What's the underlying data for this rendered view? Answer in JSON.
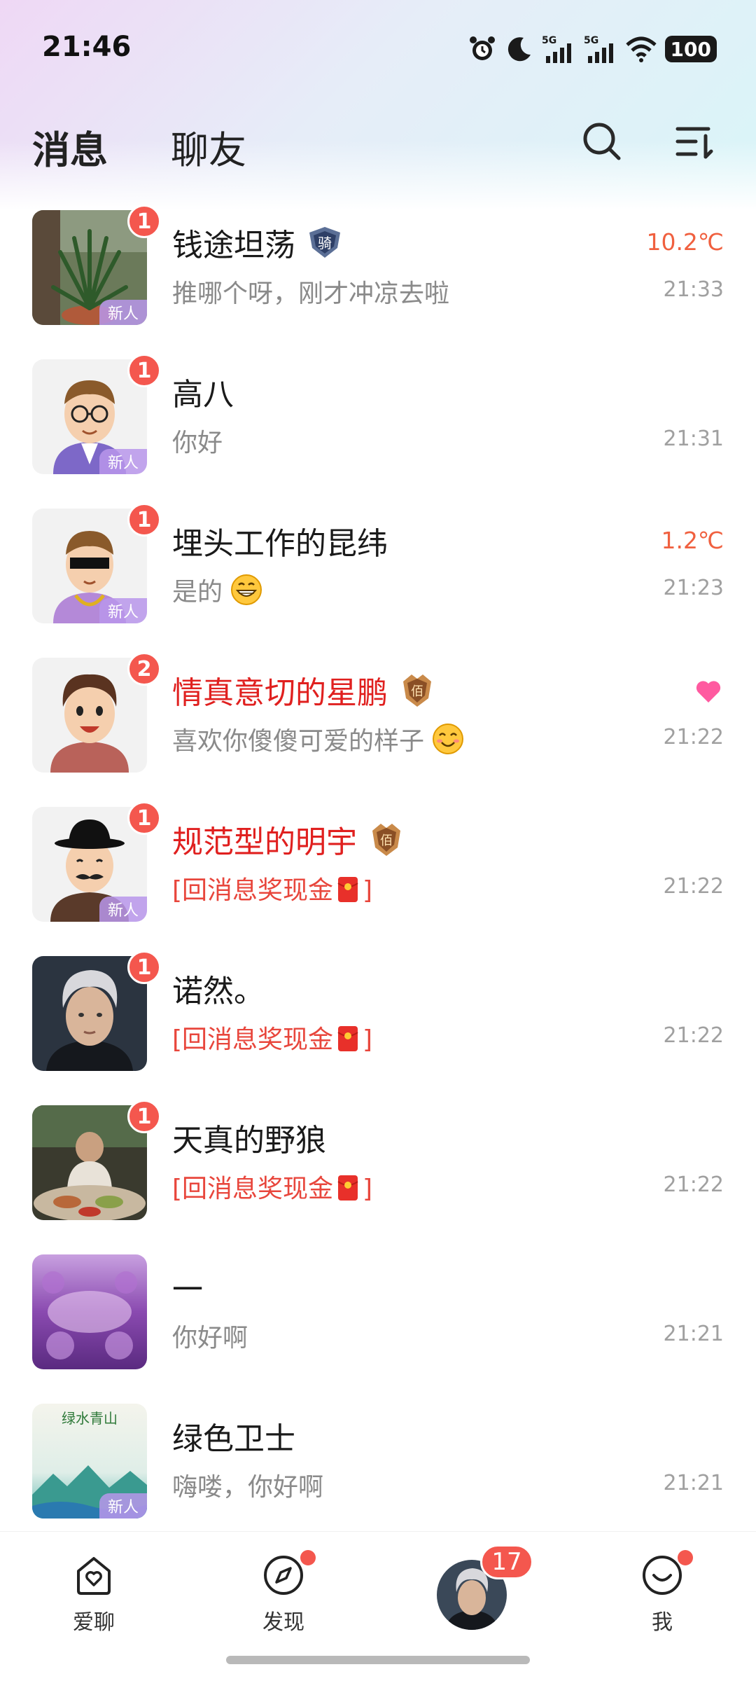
{
  "status_bar": {
    "time": "21:46",
    "battery": "100",
    "network_1": "5G",
    "network_2": "5G"
  },
  "header": {
    "tabs": [
      {
        "label": "消息",
        "active": true
      },
      {
        "label": "聊友",
        "active": false
      }
    ]
  },
  "conversations": [
    {
      "name": "钱途坦荡",
      "preview": "推哪个呀，刚才冲凉去啦",
      "time": "21:33",
      "temperature": "10.2℃",
      "unread": "1",
      "new_tag": "新人",
      "badge": "骑"
    },
    {
      "name": "高八",
      "preview": "你好",
      "time": "21:31",
      "unread": "1",
      "new_tag": "新人"
    },
    {
      "name": "埋头工作的昆纬",
      "preview": "是的",
      "time": "21:23",
      "temperature": "1.2℃",
      "unread": "1",
      "new_tag": "新人"
    },
    {
      "name": "情真意切的星鹏",
      "preview": "喜欢你傻傻可爱的样子",
      "time": "21:22",
      "unread": "2",
      "badge": "佰"
    },
    {
      "name": "规范型的明宇",
      "preview_prefix": "[回消息奖现金",
      "preview_suffix": "]",
      "time": "21:22",
      "unread": "1",
      "new_tag": "新人",
      "badge": "佰"
    },
    {
      "name": "诺然。",
      "preview_prefix": "[回消息奖现金",
      "preview_suffix": "]",
      "time": "21:22",
      "unread": "1"
    },
    {
      "name": "天真的野狼",
      "preview_prefix": "[回消息奖现金",
      "preview_suffix": "]",
      "time": "21:22",
      "unread": "1"
    },
    {
      "name": "一",
      "preview": "你好啊",
      "time": "21:21"
    },
    {
      "name": "绿色卫士",
      "preview": "嗨喽，你好啊",
      "time": "21:21",
      "new_tag": "新人",
      "avatar_text": "绿水青山"
    }
  ],
  "bottom_nav": {
    "items": [
      {
        "label": "爱聊"
      },
      {
        "label": "发现"
      },
      {
        "label": ""
      },
      {
        "label": "我"
      }
    ],
    "me_badge": "17"
  },
  "colors": {
    "accent_red": "#f4574e",
    "name_red": "#e0201f",
    "temp_orange": "#f0603f",
    "tab_underline": "#b07ae8",
    "heart": "#ff5aa0"
  },
  "icons": [
    "alarm-icon",
    "moon-icon",
    "signal-icon",
    "wifi-icon",
    "search-icon",
    "sort-icon",
    "heart-icon",
    "red-packet-icon",
    "home-heart-icon",
    "compass-icon",
    "smile-icon"
  ]
}
